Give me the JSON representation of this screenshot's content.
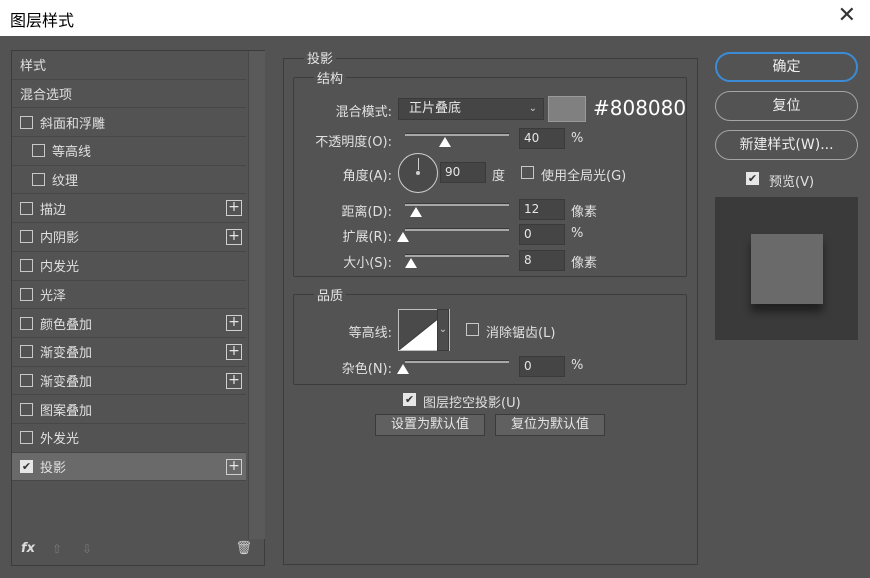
{
  "window": {
    "title": "图层样式",
    "close_glyph": "✕"
  },
  "left": {
    "items": [
      {
        "label": "样式",
        "type": "header"
      },
      {
        "label": "混合选项",
        "type": "header"
      },
      {
        "label": "斜面和浮雕",
        "type": "check",
        "checked": false,
        "plus": false
      },
      {
        "label": "等高线",
        "type": "check-indent",
        "checked": false,
        "plus": false
      },
      {
        "label": "纹理",
        "type": "check-indent",
        "checked": false,
        "plus": false
      },
      {
        "label": "描边",
        "type": "check",
        "checked": false,
        "plus": true
      },
      {
        "label": "内阴影",
        "type": "check",
        "checked": false,
        "plus": true
      },
      {
        "label": "内发光",
        "type": "check",
        "checked": false,
        "plus": false
      },
      {
        "label": "光泽",
        "type": "check",
        "checked": false,
        "plus": false
      },
      {
        "label": "颜色叠加",
        "type": "check",
        "checked": false,
        "plus": true
      },
      {
        "label": "渐变叠加",
        "type": "check",
        "checked": false,
        "plus": true
      },
      {
        "label": "渐变叠加",
        "type": "check",
        "checked": false,
        "plus": true
      },
      {
        "label": "图案叠加",
        "type": "check",
        "checked": false,
        "plus": false
      },
      {
        "label": "外发光",
        "type": "check",
        "checked": false,
        "plus": false
      },
      {
        "label": "投影",
        "type": "check",
        "checked": true,
        "plus": true,
        "selected": true
      }
    ],
    "footer": {
      "fx": "fx",
      "up": "⇧",
      "down": "⇩",
      "trash": "🗑"
    }
  },
  "middle": {
    "section_title": "投影",
    "structure": {
      "title": "结构",
      "blend_mode_label": "混合模式:",
      "blend_mode_value": "正片叠底",
      "color_hex": "#808080",
      "swatch_color": "#808080",
      "opacity_label": "不透明度(O):",
      "opacity_value": "40",
      "opacity_unit": "%",
      "opacity_level": 0.4,
      "angle_label": "角度(A):",
      "angle_value": "90",
      "angle_unit": "度",
      "global_light_label": "使用全局光(G)",
      "global_light_checked": false,
      "distance_label": "距离(D):",
      "distance_value": "12",
      "distance_unit": "像素",
      "spread_label": "扩展(R):",
      "spread_value": "0",
      "spread_unit": "%",
      "size_label": "大小(S):",
      "size_value": "8",
      "size_unit": "像素"
    },
    "quality": {
      "title": "品质",
      "contour_label": "等高线:",
      "antialias_label": "消除锯齿(L)",
      "antialias_checked": false,
      "noise_label": "杂色(N):",
      "noise_value": "0",
      "noise_unit": "%"
    },
    "knockout_label": "图层挖空投影(U)",
    "knockout_checked": true,
    "set_default_label": "设置为默认值",
    "reset_default_label": "复位为默认值"
  },
  "right": {
    "ok_label": "确定",
    "reset_label": "复位",
    "new_style_label": "新建样式(W)...",
    "preview_label": "预览(V)",
    "preview_checked": true
  }
}
